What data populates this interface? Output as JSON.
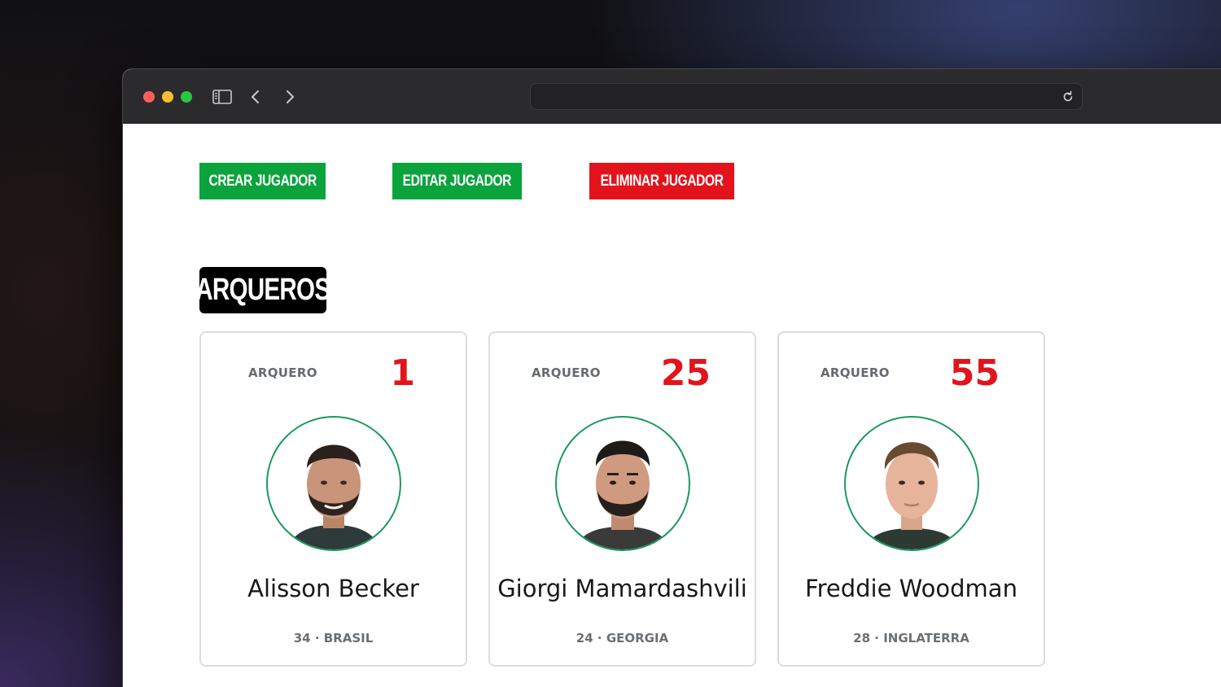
{
  "colors": {
    "green": "#0aa33c",
    "red": "#e3131b",
    "avatar_ring": "#1a9a5a"
  },
  "browser": {
    "sidebar_icon": "sidebar-icon",
    "back_icon": "chevron-left-icon",
    "forward_icon": "chevron-right-icon",
    "reload_icon": "reload-icon",
    "url": ""
  },
  "actions": {
    "create_label": "CREAR JUGADOR",
    "edit_label": "EDITAR JUGADOR",
    "delete_label": "ELIMINAR JUGADOR"
  },
  "section": {
    "title": "ARQUEROS"
  },
  "players": [
    {
      "position": "ARQUERO",
      "number": "1",
      "name": "Alisson Becker",
      "meta": "34 · BRASIL"
    },
    {
      "position": "ARQUERO",
      "number": "25",
      "name": "Giorgi Mamardashvili",
      "meta": "24 · GEORGIA"
    },
    {
      "position": "ARQUERO",
      "number": "55",
      "name": "Freddie Woodman",
      "meta": "28 · INGLATERRA"
    }
  ]
}
